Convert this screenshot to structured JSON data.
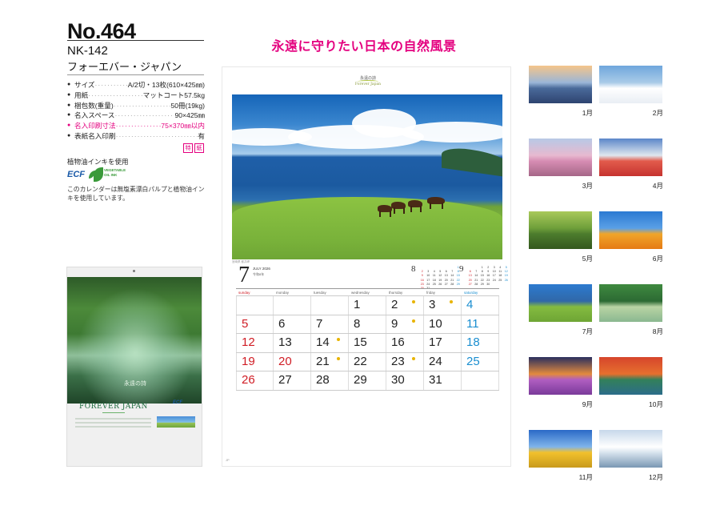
{
  "product": {
    "number": "No.464",
    "model": "NK-142",
    "name": "フォーエバー・ジャパン"
  },
  "specs": [
    {
      "key": "サイズ",
      "value": "A/2切・13枚(610×425㎜)",
      "highlight": false
    },
    {
      "key": "用紙",
      "value": "マットコート57.5kg",
      "highlight": false
    },
    {
      "key": "梱包数(重量)",
      "value": "50冊(19kg)",
      "highlight": false
    },
    {
      "key": "名入スペース",
      "value": "90×425㎜",
      "highlight": false
    },
    {
      "key": "名入印刷寸法",
      "value": "75×370㎜以内",
      "highlight": true
    },
    {
      "key": "表紙名入印刷",
      "value": "有",
      "highlight": false
    }
  ],
  "marks": [
    "特",
    "紙"
  ],
  "ink_label": "植物油インキを使用",
  "ecf_label": "ECF",
  "veg_label": "VEGETABLE OIL INK",
  "paper_note": "このカレンダーは無塩素漂白パルプと植物油インキを使用しています。",
  "cover": {
    "title": "永遠の詩",
    "brand": "FOREVER JAPAN",
    "ecf": "ECF"
  },
  "headline": "永遠に守りたい日本の自然風景",
  "calendar": {
    "logo_title": "永遠の詩",
    "logo_sub": "Forever Japan",
    "month_number": "7",
    "month_name": "JULY 2026",
    "era": "令和8年",
    "photo_caption": "宮崎県 都井岬",
    "footer": "JP",
    "weekdays": [
      "sunday",
      "monday",
      "tuesday",
      "wednesday",
      "thursday",
      "friday",
      "saturday"
    ],
    "weeks": [
      [
        "",
        "",
        "",
        "1",
        "2",
        "3",
        "4"
      ],
      [
        "5",
        "6",
        "7",
        "8",
        "9",
        "10",
        "11"
      ],
      [
        "12",
        "13",
        "14",
        "15",
        "16",
        "17",
        "18"
      ],
      [
        "19",
        "20",
        "21",
        "22",
        "23",
        "24",
        "25"
      ],
      [
        "26",
        "27",
        "28",
        "29",
        "30",
        "31",
        ""
      ]
    ],
    "holidays": [
      "20"
    ],
    "mini_prev": {
      "number": "8",
      "days": [
        "",
        "",
        "",
        "",
        "",
        "",
        "1",
        "2",
        "3",
        "4",
        "5",
        "6",
        "7",
        "8",
        "9",
        "10",
        "11",
        "12",
        "13",
        "14",
        "15",
        "16",
        "17",
        "18",
        "19",
        "20",
        "21",
        "22",
        "23",
        "24",
        "25",
        "26",
        "27",
        "28",
        "29",
        "30",
        "31"
      ]
    },
    "mini_next": {
      "number": "9",
      "days": [
        "",
        "",
        "1",
        "2",
        "3",
        "4",
        "5",
        "6",
        "7",
        "8",
        "9",
        "10",
        "11",
        "12",
        "13",
        "14",
        "15",
        "16",
        "17",
        "18",
        "19",
        "20",
        "21",
        "22",
        "23",
        "24",
        "25",
        "26",
        "27",
        "28",
        "29",
        "30"
      ]
    }
  },
  "thumbnails": [
    {
      "label": "1月",
      "colors": [
        "#f5c58a",
        "#9ab6d8",
        "#4a6a9a",
        "#2e4470"
      ]
    },
    {
      "label": "2月",
      "colors": [
        "#6fa6dc",
        "#a9cbe8",
        "#ffffff",
        "#e9eef4"
      ]
    },
    {
      "label": "3月",
      "colors": [
        "#b8c9e6",
        "#e7b9cf",
        "#d68db3",
        "#a56687"
      ]
    },
    {
      "label": "4月",
      "colors": [
        "#5b86c9",
        "#dfe7ef",
        "#e25b4c",
        "#c6332f"
      ]
    },
    {
      "label": "5月",
      "colors": [
        "#a9c95a",
        "#6e9f3a",
        "#4d7c2d",
        "#34581e"
      ]
    },
    {
      "label": "6月",
      "colors": [
        "#2b79d2",
        "#5aa0e6",
        "#f0a52a",
        "#e57a14"
      ]
    },
    {
      "label": "7月",
      "colors": [
        "#2d7bd0",
        "#3068a8",
        "#84bb40",
        "#6ea535"
      ]
    },
    {
      "label": "8月",
      "colors": [
        "#3f8a40",
        "#2c6a33",
        "#b9d4a4",
        "#8ab890"
      ]
    },
    {
      "label": "9月",
      "colors": [
        "#2a2f5e",
        "#e38a3e",
        "#b05ec1",
        "#7a3a9a"
      ]
    },
    {
      "label": "10月",
      "colors": [
        "#d6452c",
        "#e66f2e",
        "#33805a",
        "#2c6d8a"
      ]
    },
    {
      "label": "11月",
      "colors": [
        "#2a69c7",
        "#7fb4ea",
        "#f2c12c",
        "#c89a1c"
      ]
    },
    {
      "label": "12月",
      "colors": [
        "#c7d8ea",
        "#ffffff",
        "#d8e4ee",
        "#7a97b3"
      ]
    }
  ]
}
